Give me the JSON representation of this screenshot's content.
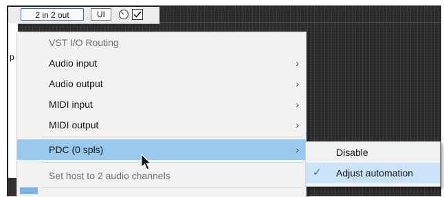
{
  "toolbar": {
    "io_button_label": "2 in 2 out",
    "ui_button_label": "UI",
    "knob_icon": "knob-icon",
    "checkbox_checked": true
  },
  "background": {
    "left_strip_text": "p"
  },
  "menu": {
    "header": "VST I/O Routing",
    "items": [
      {
        "label": "Audio input",
        "has_submenu": true
      },
      {
        "label": "Audio output",
        "has_submenu": true
      },
      {
        "label": "MIDI input",
        "has_submenu": true
      },
      {
        "label": "MIDI output",
        "has_submenu": true
      },
      {
        "label": "PDC (0 spls)",
        "has_submenu": true,
        "highlighted": true
      },
      {
        "label": "Set host to 2 audio channels",
        "disabled": true
      }
    ],
    "arrow_glyph": "›"
  },
  "submenu": {
    "items": [
      {
        "label": "Disable",
        "checked": false
      },
      {
        "label": "Adjust automation",
        "checked": true
      }
    ],
    "check_glyph": "✓"
  },
  "colors": {
    "highlight": "#99c9ef",
    "submenu_hover": "#cbe3f8",
    "accent": "#2b6fb5"
  }
}
